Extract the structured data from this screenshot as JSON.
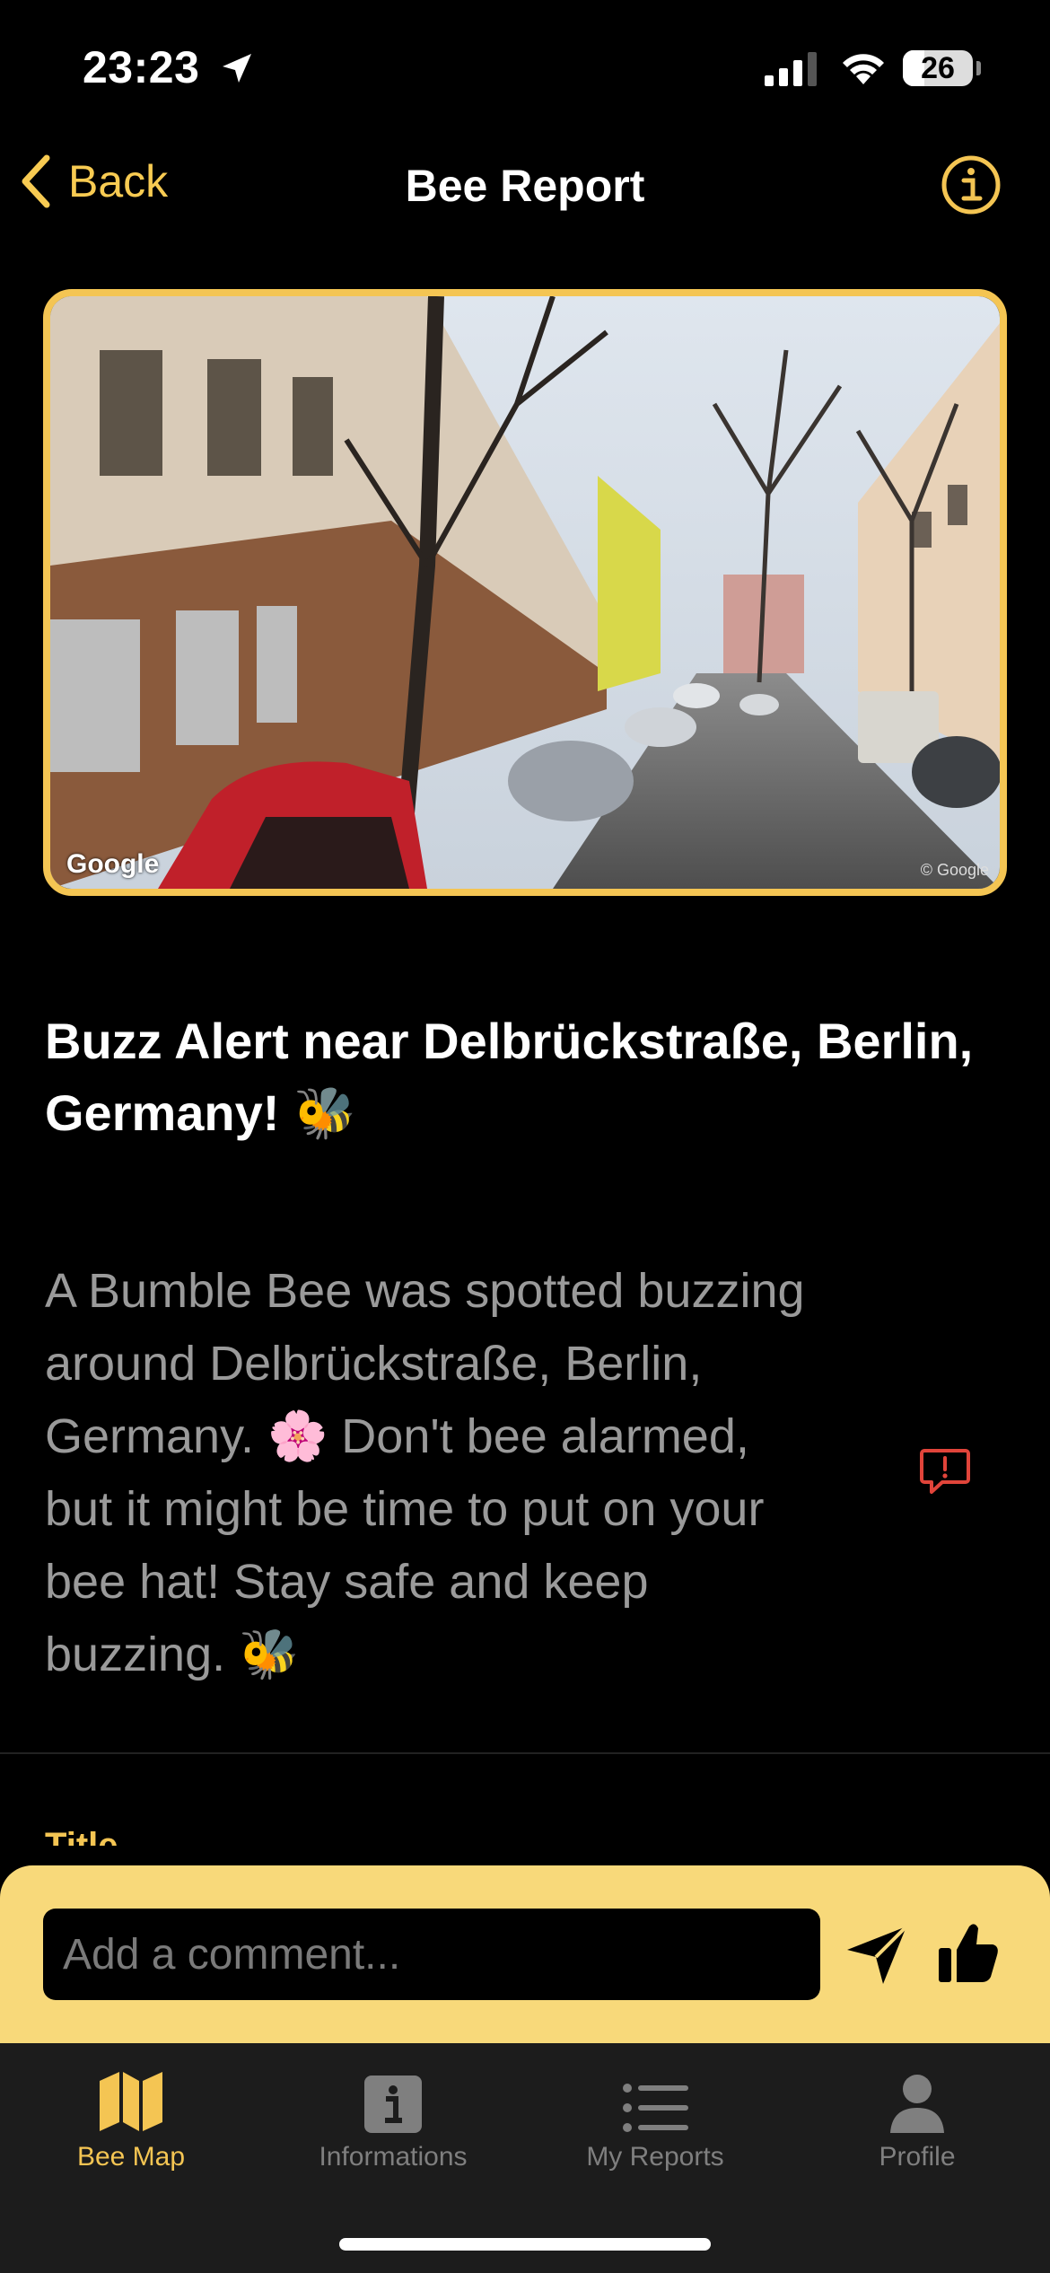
{
  "status_bar": {
    "time": "23:23",
    "battery": "26"
  },
  "nav": {
    "back_label": "Back",
    "title": "Bee Report"
  },
  "photo": {
    "watermark": "Google",
    "copyright": "© Google"
  },
  "report": {
    "title": "Buzz Alert near Delbrückstraße, Berlin, Germany! 🐝",
    "body": "A Bumble Bee was spotted buzzing around Delbrückstraße, Berlin, Germany. 🌸 Don't bee alarmed, but it might be time to put on your bee hat! Stay safe and keep buzzing. 🐝",
    "next_field_label": "Title"
  },
  "comment": {
    "placeholder": "Add a comment..."
  },
  "tabs": [
    {
      "label": "Bee Map",
      "icon": "map-icon",
      "active": true
    },
    {
      "label": "Informations",
      "icon": "info-square-icon",
      "active": false
    },
    {
      "label": "My Reports",
      "icon": "list-icon",
      "active": false
    },
    {
      "label": "Profile",
      "icon": "person-icon",
      "active": false
    }
  ],
  "colors": {
    "accent": "#f4c553",
    "comment_bar": "#f8d97a",
    "flag_icon": "#e0443a"
  }
}
